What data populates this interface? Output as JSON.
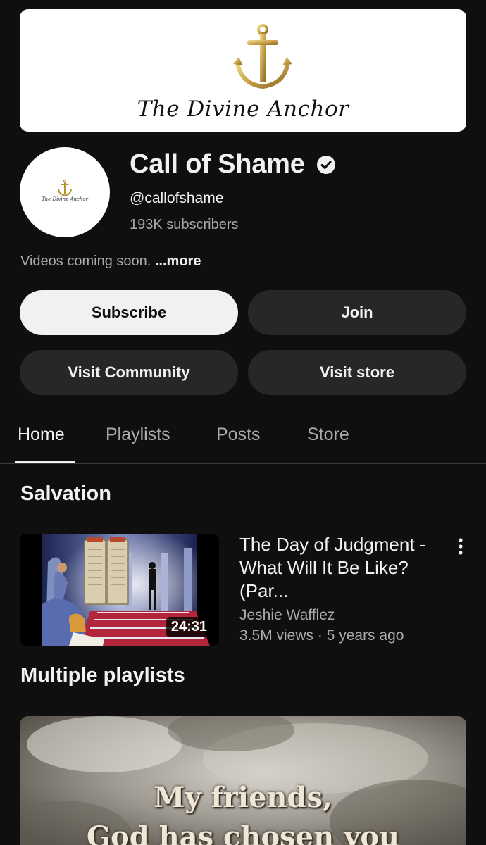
{
  "banner": {
    "text": "The Divine Anchor",
    "icon": "anchor-icon"
  },
  "avatar": {
    "text": "The Divine Anchor",
    "icon": "anchor-icon"
  },
  "channel": {
    "name": "Call of Shame",
    "handle": "@callofshame",
    "subscribers": "193K subscribers",
    "description": "Videos coming soon.",
    "more_label": "...more",
    "verified_icon": "verified-check-icon"
  },
  "buttons": {
    "subscribe": "Subscribe",
    "join": "Join",
    "visit_community": "Visit Community",
    "visit_store": "Visit store"
  },
  "tabs": [
    {
      "label": "Home",
      "active": true
    },
    {
      "label": "Playlists",
      "active": false
    },
    {
      "label": "Posts",
      "active": false
    },
    {
      "label": "Store",
      "active": false
    }
  ],
  "sections": [
    {
      "title": "Salvation",
      "video": {
        "title": "The Day of Judgment - What Will It Be Like? (Par...",
        "author": "Jeshie Wafflez",
        "meta": "3.5M views · 5 years ago",
        "duration": "24:31"
      }
    },
    {
      "title": "Multiple playlists",
      "playlist_text": [
        "My friends,",
        "God has chosen you"
      ]
    }
  ],
  "colors": {
    "background": "#0f0f0f",
    "button_dark": "#272727",
    "button_light": "#f1f1f1",
    "secondary_text": "#aaaaaa",
    "anchor_gold": "#c9a24a"
  }
}
